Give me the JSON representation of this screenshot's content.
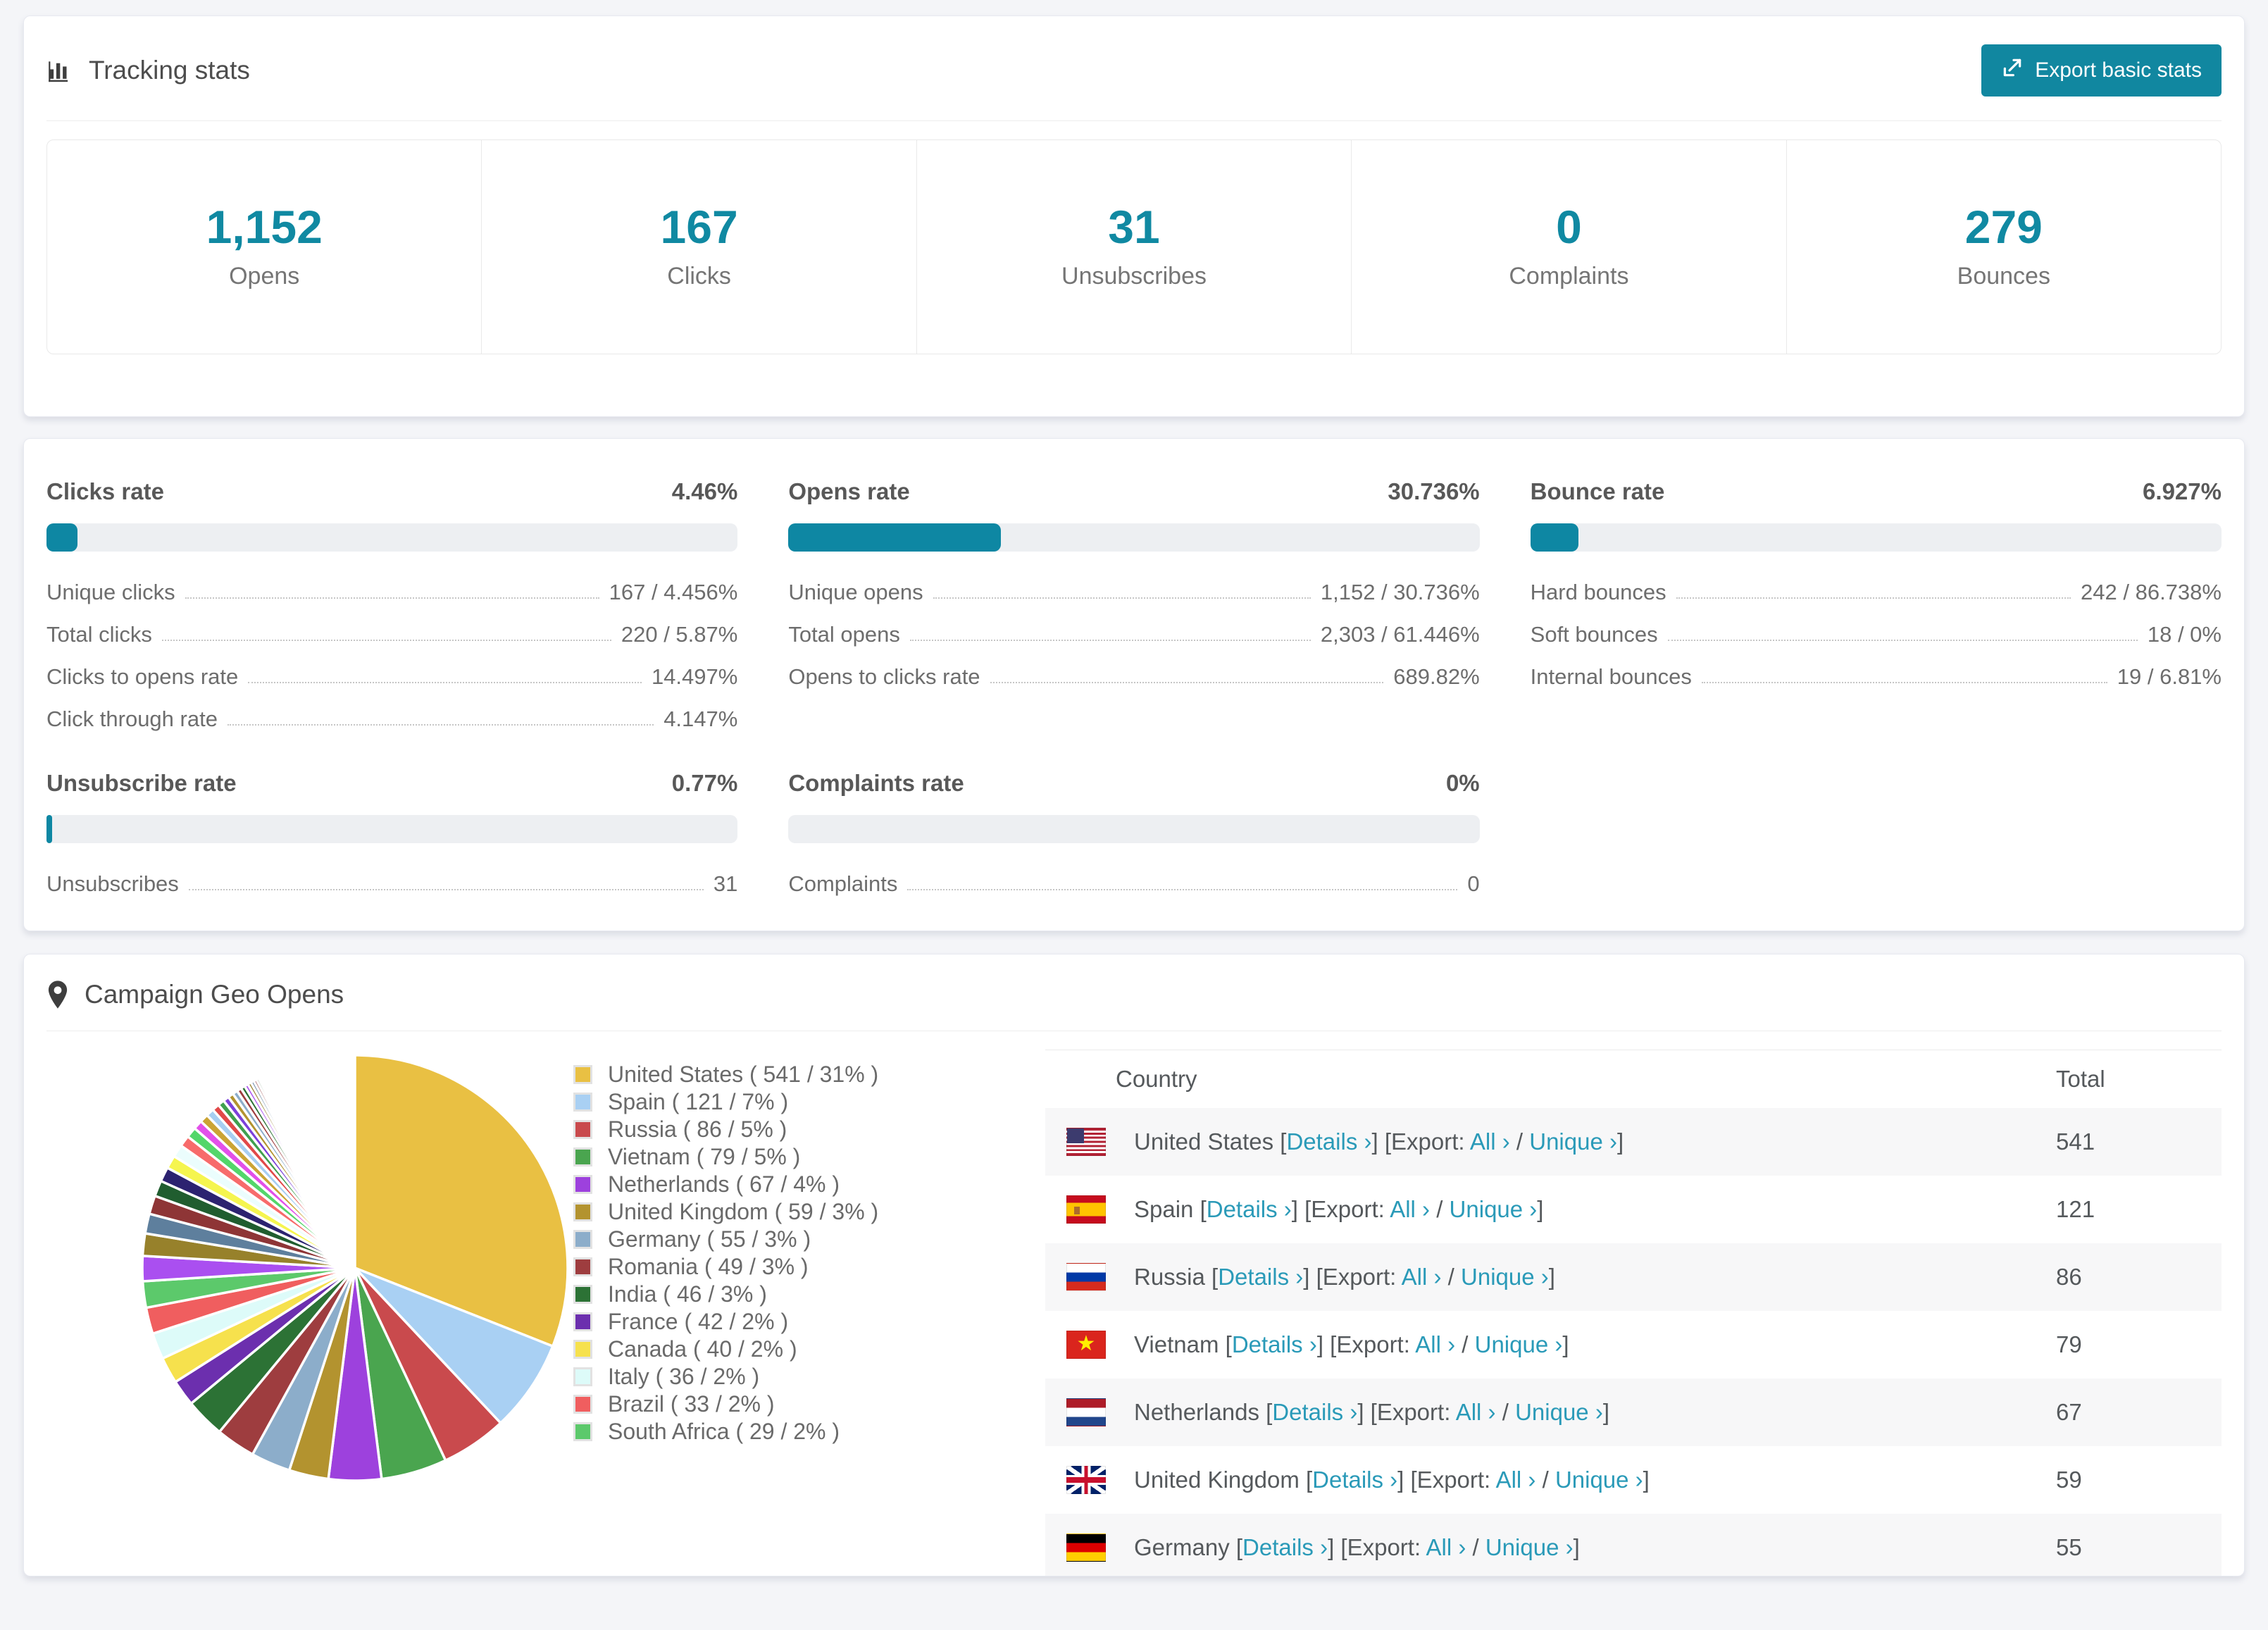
{
  "accent": "#1089a2",
  "link_color": "#2a9ab8",
  "page_bg": "#f4f5f8",
  "tracking": {
    "title": "Tracking stats",
    "export_button": "Export basic stats",
    "stats": [
      {
        "value": "1,152",
        "label": "Opens"
      },
      {
        "value": "167",
        "label": "Clicks"
      },
      {
        "value": "31",
        "label": "Unsubscribes"
      },
      {
        "value": "0",
        "label": "Complaints"
      },
      {
        "value": "279",
        "label": "Bounces"
      }
    ]
  },
  "rates": {
    "panels": [
      {
        "title": "Clicks rate",
        "value": "4.46%",
        "percent": 4.46,
        "rows": [
          {
            "label": "Unique clicks",
            "value": "167 / 4.456%"
          },
          {
            "label": "Total clicks",
            "value": "220 / 5.87%"
          },
          {
            "label": "Clicks to opens rate",
            "value": "14.497%"
          },
          {
            "label": "Click through rate",
            "value": "4.147%"
          }
        ]
      },
      {
        "title": "Opens rate",
        "value": "30.736%",
        "percent": 30.736,
        "rows": [
          {
            "label": "Unique opens",
            "value": "1,152 / 30.736%"
          },
          {
            "label": "Total opens",
            "value": "2,303 / 61.446%"
          },
          {
            "label": "Opens to clicks rate",
            "value": "689.82%"
          }
        ]
      },
      {
        "title": "Bounce rate",
        "value": "6.927%",
        "percent": 6.927,
        "rows": [
          {
            "label": "Hard bounces",
            "value": "242 / 86.738%"
          },
          {
            "label": "Soft bounces",
            "value": "18 / 0%"
          },
          {
            "label": "Internal bounces",
            "value": "19 / 6.81%"
          }
        ]
      },
      {
        "title": "Unsubscribe rate",
        "value": "0.77%",
        "percent": 0.77,
        "rows": [
          {
            "label": "Unsubscribes",
            "value": "31"
          }
        ]
      },
      {
        "title": "Complaints rate",
        "value": "0%",
        "percent": 0,
        "rows": [
          {
            "label": "Complaints",
            "value": "0"
          }
        ]
      }
    ]
  },
  "geo": {
    "title": "Campaign Geo Opens",
    "table": {
      "headers": {
        "country": "Country",
        "total": "Total"
      },
      "labels": {
        "open_bracket": "[",
        "close_bracket": "]",
        "details": "Details ›",
        "export": "Export:",
        "all": "All ›",
        "slash": "/",
        "unique": "Unique ›"
      },
      "rows": [
        {
          "flag": "us",
          "name": "United States",
          "total": "541"
        },
        {
          "flag": "es",
          "name": "Spain",
          "total": "121"
        },
        {
          "flag": "ru",
          "name": "Russia",
          "total": "86"
        },
        {
          "flag": "vn",
          "name": "Vietnam",
          "total": "79"
        },
        {
          "flag": "nl",
          "name": "Netherlands",
          "total": "67"
        },
        {
          "flag": "gb",
          "name": "United Kingdom",
          "total": "59"
        },
        {
          "flag": "de",
          "name": "Germany",
          "total": "55"
        }
      ]
    }
  },
  "chart_data": {
    "type": "pie",
    "title": "Campaign Geo Opens",
    "legend_position": "right",
    "start_angle": 0,
    "slices": [
      {
        "label": "United States",
        "value": 541,
        "pct": 31,
        "color": "#e9c043"
      },
      {
        "label": "Spain",
        "value": 121,
        "pct": 7,
        "color": "#a9d0f3"
      },
      {
        "label": "Russia",
        "value": 86,
        "pct": 5,
        "color": "#c94a4d"
      },
      {
        "label": "Vietnam",
        "value": 79,
        "pct": 5,
        "color": "#4aa54f"
      },
      {
        "label": "Netherlands",
        "value": 67,
        "pct": 4,
        "color": "#9d41dd"
      },
      {
        "label": "United Kingdom",
        "value": 59,
        "pct": 3,
        "color": "#b3932f"
      },
      {
        "label": "Germany",
        "value": 55,
        "pct": 3,
        "color": "#8cadca"
      },
      {
        "label": "Romania",
        "value": 49,
        "pct": 3,
        "color": "#9e3d3f"
      },
      {
        "label": "India",
        "value": 46,
        "pct": 3,
        "color": "#2c7235"
      },
      {
        "label": "France",
        "value": 42,
        "pct": 2,
        "color": "#6c2fae"
      },
      {
        "label": "Canada",
        "value": 40,
        "pct": 2,
        "color": "#f6e14d"
      },
      {
        "label": "Italy",
        "value": 36,
        "pct": 2,
        "color": "#ddfbf9"
      },
      {
        "label": "Brazil",
        "value": 33,
        "pct": 2,
        "color": "#f05e5f"
      },
      {
        "label": "South Africa",
        "value": 29,
        "pct": 2,
        "color": "#5cc96b"
      }
    ],
    "legend_format": "{label} ( {value} / {pct}% )",
    "tail_percents": [
      1.9,
      1.7,
      1.5,
      1.4,
      1.2,
      1.1,
      1.0,
      0.95,
      0.85,
      0.8,
      0.7,
      0.65,
      0.6,
      0.55,
      0.5,
      0.45,
      0.42,
      0.38,
      0.35,
      0.32,
      0.28,
      0.26,
      0.24,
      0.22,
      0.2,
      0.18,
      0.16,
      0.15,
      0.13,
      0.12,
      0.11,
      0.1,
      0.09,
      0.08,
      0.07,
      0.065,
      0.06,
      0.055,
      0.05,
      0.045
    ],
    "tail_palette": [
      "#aa4ff0",
      "#97812b",
      "#5e7f9d",
      "#8e3536",
      "#205d2f",
      "#2c2270",
      "#f5f54f",
      "#ebfdfd",
      "#f76b6b",
      "#53d66a",
      "#e250e9",
      "#cba434",
      "#a7cef1",
      "#e14949",
      "#40a04f",
      "#7c40da",
      "#b3932f",
      "#8cadca",
      "#9e3d3f",
      "#2c7235"
    ]
  }
}
